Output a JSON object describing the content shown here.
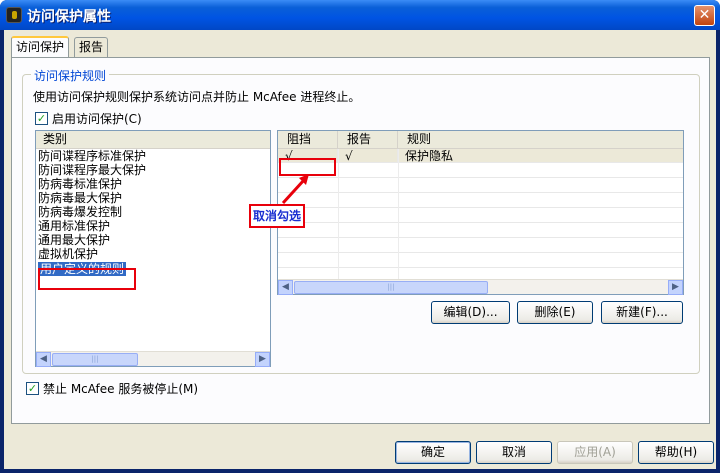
{
  "window": {
    "title": "访问保护属性",
    "close": "✕"
  },
  "tabs": [
    {
      "label": "访问保护"
    },
    {
      "label": "报告"
    }
  ],
  "group": {
    "legend": "访问保护规则",
    "description": "使用访问保护规则保护系统访问点并防止 McAfee 进程终止。",
    "enable_checkbox": {
      "label": "启用访问保护(C)",
      "checked": true
    }
  },
  "category_list": {
    "header": "类别",
    "items": [
      "防间谍程序标准保护",
      "防间谍程序最大保护",
      "防病毒标准保护",
      "防病毒最大保护",
      "防病毒爆发控制",
      "通用标准保护",
      "通用最大保护",
      "虚拟机保护",
      "用户定义的规则"
    ],
    "selected_index": 8
  },
  "rules_table": {
    "columns": [
      "阻挡",
      "报告",
      "规则"
    ],
    "rows": [
      {
        "block": "√",
        "report": "√",
        "rule": "保护隐私"
      }
    ]
  },
  "rule_buttons": {
    "edit": "编辑(D)...",
    "delete": "删除(E)",
    "new": "新建(F)..."
  },
  "annotation": {
    "callout": "取消勾选",
    "accent_color": "#e8000b"
  },
  "prevent_stop_checkbox": {
    "label": "禁止 McAfee 服务被停止(M)",
    "checked": true
  },
  "dialog_buttons": {
    "ok": "确定",
    "cancel": "取消",
    "apply": "应用(A)",
    "help": "帮助(H)"
  },
  "icons": {
    "scroll_left": "◀",
    "scroll_right": "▶",
    "grip": "|||"
  }
}
